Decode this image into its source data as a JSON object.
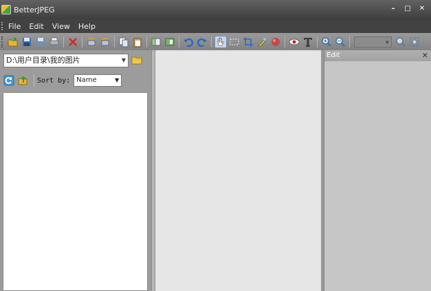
{
  "window": {
    "title": "BetterJPEG",
    "controls": {
      "minimize": "–",
      "maximize": "□",
      "close": "✕"
    }
  },
  "menu": {
    "items": [
      "File",
      "Edit",
      "View",
      "Help"
    ]
  },
  "toolbar": {
    "buttons": [
      "open-icon",
      "save-icon",
      "save-as-icon",
      "print-icon",
      "delete-icon",
      "rotate-left-file-icon",
      "rotate-right-file-icon",
      "copy-icon",
      "paste-icon",
      "batch-icon",
      "export-icon",
      "undo-icon",
      "redo-icon",
      "hand-tool-icon",
      "select-rect-icon",
      "crop-icon",
      "retouch-icon",
      "color-icon",
      "red-eye-icon",
      "text-icon",
      "zoom-in-icon",
      "zoom-out-icon",
      "zoom-select",
      "zoom-actual-icon",
      "fit-window-icon"
    ],
    "active_tool": "hand-tool-icon"
  },
  "browser": {
    "path": "D:\\用户目录\\我的图片",
    "sort_label": "Sort by:",
    "sort_value": "Name"
  },
  "edit_panel": {
    "title": "Edit",
    "close": "✕"
  },
  "colors": {
    "titlebar": "#4a4a4a",
    "toolbar": "#8f8f8f",
    "canvas": "#e6e6e6",
    "panel": "#c6c6c6"
  }
}
